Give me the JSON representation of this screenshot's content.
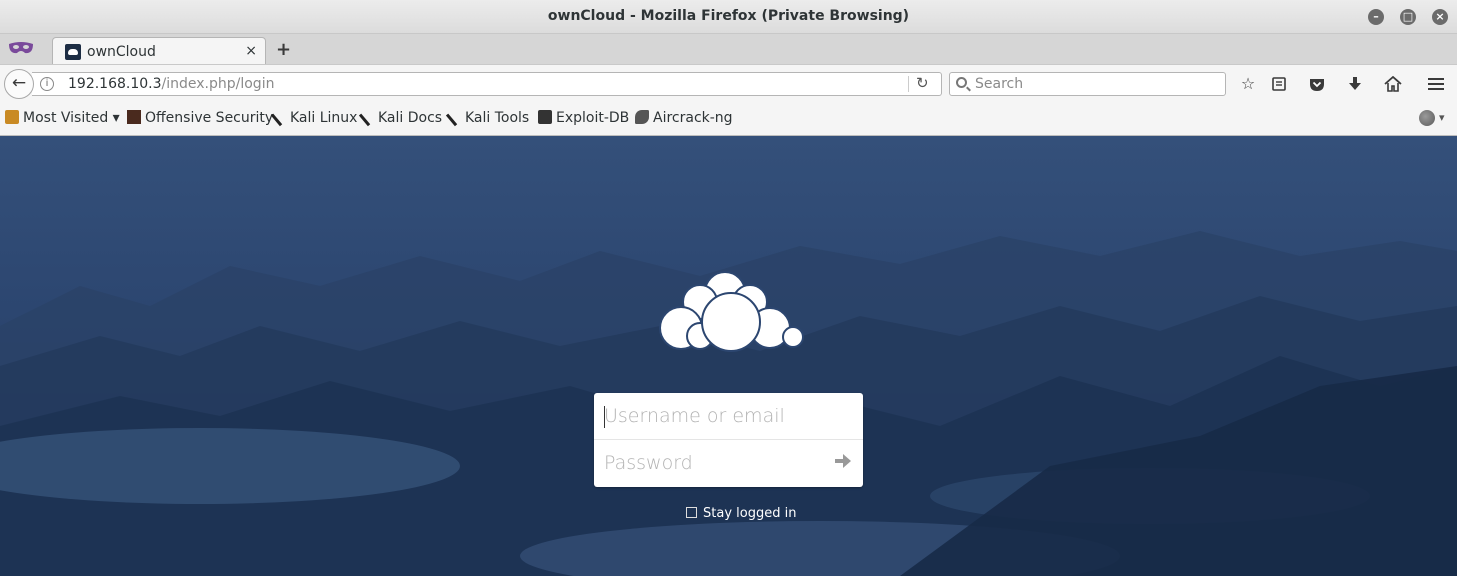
{
  "window": {
    "title": "ownCloud - Mozilla Firefox (Private Browsing)"
  },
  "tabs": [
    {
      "label": "ownCloud",
      "close": "×"
    }
  ],
  "newtab": "+",
  "navbar": {
    "back": "←",
    "info": "i",
    "url_host": "192.168.10.3",
    "url_path": "/index.php/login",
    "reload": "↻",
    "search_placeholder": "Search",
    "icons": [
      "bookmark-star-icon",
      "reader-list-icon",
      "pocket-icon",
      "download-icon",
      "home-icon",
      "menu-icon"
    ]
  },
  "bookmarks": [
    {
      "label": "Most Visited ▾",
      "icon": "folder"
    },
    {
      "label": "Offensive Security",
      "icon": "os"
    },
    {
      "label": "Kali Linux",
      "icon": "kali"
    },
    {
      "label": "Kali Docs",
      "icon": "kali"
    },
    {
      "label": "Kali Tools",
      "icon": "kali"
    },
    {
      "label": "Exploit-DB",
      "icon": "edb"
    },
    {
      "label": "Aircrack-ng",
      "icon": "air"
    }
  ],
  "login": {
    "username_placeholder": "Username or email",
    "password_placeholder": "Password",
    "stay_logged_in": "Stay logged in"
  },
  "colors": {
    "background": "#2c4670",
    "private_mask": "#7a4a9b"
  }
}
